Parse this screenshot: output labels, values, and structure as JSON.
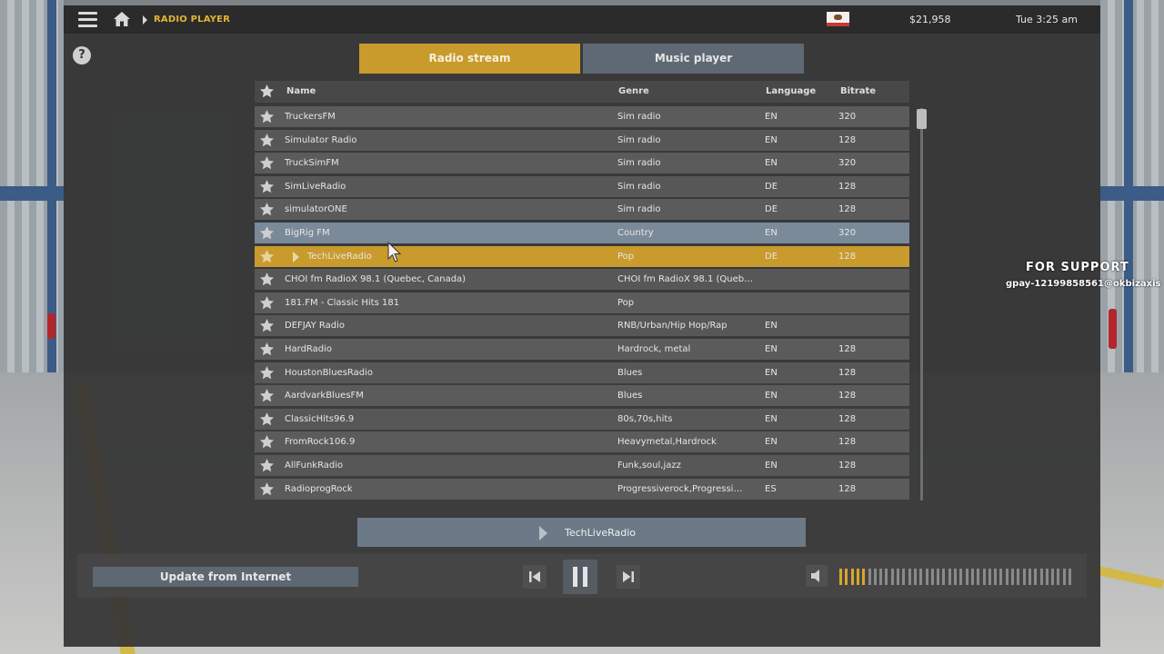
{
  "topbar": {
    "breadcrumb": "RADIO PLAYER",
    "money": "$21,958",
    "time": "Tue 3:25 am",
    "icons": {
      "menu": "hamburger-icon",
      "home": "home-icon",
      "flag": "california-flag-icon"
    }
  },
  "help": {
    "label": "?"
  },
  "tabs": [
    {
      "label": "Radio stream",
      "active": true
    },
    {
      "label": "Music player",
      "active": false
    }
  ],
  "table": {
    "columns": {
      "name": "Name",
      "genre": "Genre",
      "language": "Language",
      "bitrate": "Bitrate"
    },
    "rows": [
      {
        "name": "TruckersFM",
        "genre": "Sim radio",
        "language": "EN",
        "bitrate": "320"
      },
      {
        "name": "Simulator Radio",
        "genre": "Sim radio",
        "language": "EN",
        "bitrate": "128"
      },
      {
        "name": "TruckSimFM",
        "genre": "Sim radio",
        "language": "EN",
        "bitrate": "320"
      },
      {
        "name": "SimLiveRadio",
        "genre": "Sim radio",
        "language": "DE",
        "bitrate": "128"
      },
      {
        "name": "simulatorONE",
        "genre": "Sim radio",
        "language": "DE",
        "bitrate": "128"
      },
      {
        "name": "BigRig FM",
        "genre": "Country",
        "language": "EN",
        "bitrate": "320",
        "state": "selected"
      },
      {
        "name": "TechLiveRadio",
        "genre": "Pop",
        "language": "DE",
        "bitrate": "128",
        "state": "playing"
      },
      {
        "name": "CHOI fm RadioX 98.1 (Quebec, Canada)",
        "genre": "CHOI fm RadioX 98.1 (Queb…",
        "language": "",
        "bitrate": ""
      },
      {
        "name": "181.FM - Classic Hits 181",
        "genre": "Pop",
        "language": "",
        "bitrate": ""
      },
      {
        "name": "DEFJAY Radio",
        "genre": "RNB/Urban/Hip Hop/Rap",
        "language": "EN",
        "bitrate": ""
      },
      {
        "name": "HardRadio",
        "genre": "Hardrock, metal",
        "language": "EN",
        "bitrate": "128"
      },
      {
        "name": "HoustonBluesRadio",
        "genre": "Blues",
        "language": "EN",
        "bitrate": "128"
      },
      {
        "name": "AardvarkBluesFM",
        "genre": "Blues",
        "language": "EN",
        "bitrate": "128"
      },
      {
        "name": "ClassicHits96.9",
        "genre": "80s,70s,hits",
        "language": "EN",
        "bitrate": "128"
      },
      {
        "name": "FromRock106.9",
        "genre": "Heavymetal,Hardrock",
        "language": "EN",
        "bitrate": "128"
      },
      {
        "name": "AllFunkRadio",
        "genre": "Funk,soul,jazz",
        "language": "EN",
        "bitrate": "128"
      },
      {
        "name": "RadioprogRock",
        "genre": "Progressiverock,Progressi…",
        "language": "ES",
        "bitrate": "128"
      }
    ]
  },
  "now_playing": {
    "label": "TechLiveRadio"
  },
  "controls": {
    "update_label": "Update from Internet",
    "volume_level": 0.12,
    "volume_segments": 41
  },
  "support": {
    "title": "FOR SUPPORT",
    "id": "gpay-12199858561@okbizaxis"
  },
  "colors": {
    "accent": "#c99b2d",
    "selected": "#7b8a98",
    "panel": "#343434"
  }
}
